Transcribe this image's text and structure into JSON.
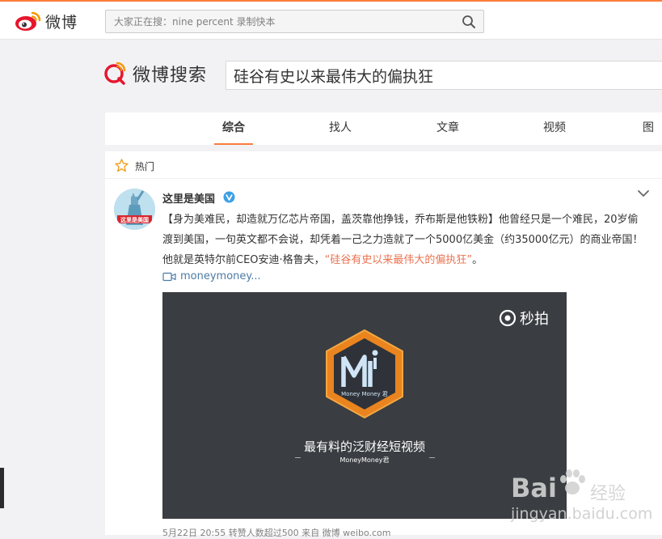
{
  "header": {
    "brand": "微博",
    "search_placeholder": "大家正在搜：nine percent 录制快本"
  },
  "search": {
    "brand": "微博搜索",
    "query": "硅谷有史以来最伟大的偏执狂"
  },
  "tabs": [
    {
      "label": "综合",
      "active": true
    },
    {
      "label": "找人",
      "active": false
    },
    {
      "label": "文章",
      "active": false
    },
    {
      "label": "视频",
      "active": false
    },
    {
      "label": "图",
      "active": false
    }
  ],
  "hot": {
    "label": "热门"
  },
  "post": {
    "avatar_caption": "这里是美国",
    "username": "这里是美国",
    "text_main": "【身为美难民，却造就万亿芯片帝国，盖茨靠他挣钱，乔布斯是他铁粉】他曾经只是一个难民，20岁偷渡到美国，一句英文都不会说，却凭着一己之力造就了一个5000亿美金（约35000亿元）的商业帝国！他就是英特尔前CEO安迪·格鲁夫，",
    "text_highlight": "“硅谷有史以来最伟大的偏执狂”",
    "text_end": "。",
    "video_link": "moneymoney...",
    "video": {
      "watermark": "秒拍",
      "logo_caption": "Money Money 君",
      "slogan": "最有料的泛财经短视频",
      "slogan_sub": "MoneyMoney君"
    },
    "footer": "5月22日 20:55 转赞人数超过500 来自 微博 weibo.com"
  },
  "watermark": {
    "brand": "Bai",
    "brand2": "经验",
    "url": "jingyan.baidu.com"
  },
  "colors": {
    "accent": "#fa7d3c",
    "link": "#4c7aa6",
    "highlight": "#eb7350",
    "video_bg": "#3a3d41"
  }
}
